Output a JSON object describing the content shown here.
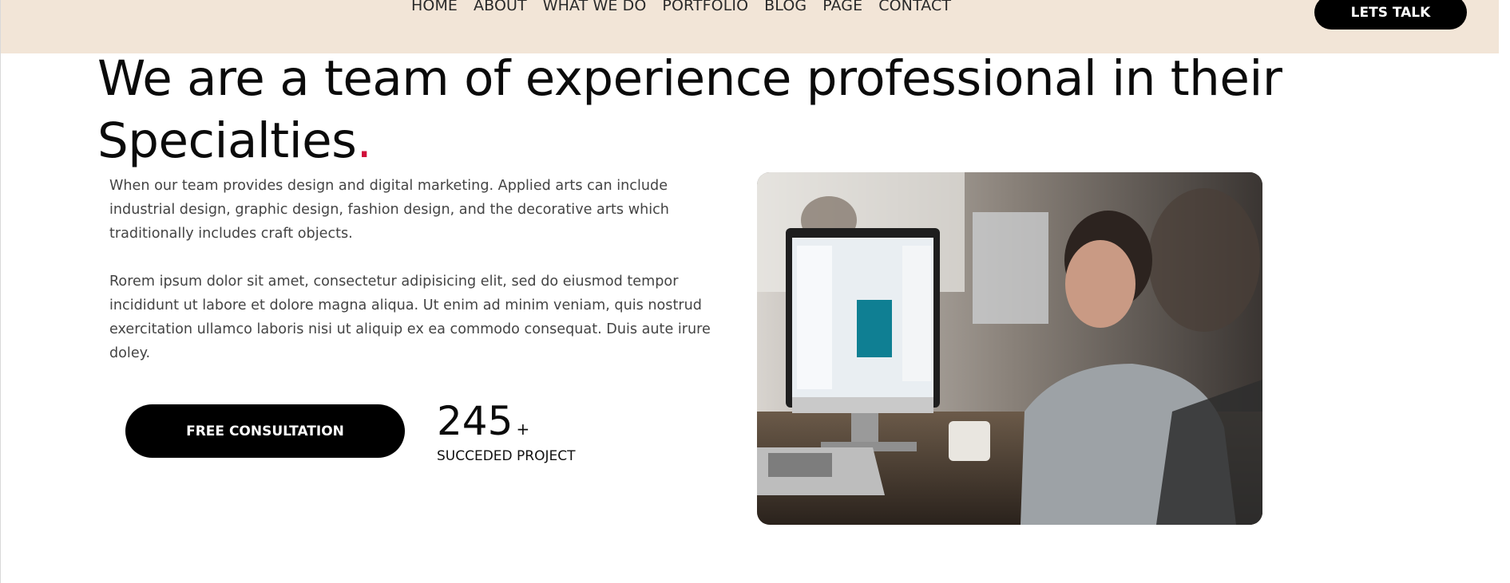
{
  "nav": {
    "links": [
      "HOME",
      "ABOUT",
      "WHAT WE DO",
      "PORTFOLIO",
      "BLOG",
      "PAGE",
      "CONTACT"
    ],
    "cta_label": "LETS TALK"
  },
  "hero": {
    "headline": "We are a team of experience professional in their Specialties",
    "headline_dot": ".",
    "paragraph_1": "When our team provides design and digital marketing. Applied arts can include industrial design, graphic design, fashion design, and the decorative arts which traditionally includes craft objects.",
    "paragraph_2": "Rorem ipsum dolor sit amet, consectetur adipisicing elit, sed do eiusmod tempor incididunt ut labore et dolore magna aliqua. Ut enim ad minim veniam, quis nostrud exercitation ullamco laboris nisi ut aliquip ex ea commodo consequat. Duis aute irure doley.",
    "cta_label": "FREE CONSULTATION",
    "stat_number": "245",
    "stat_suffix": "+",
    "stat_label": "SUCCEDED PROJECT"
  },
  "colors": {
    "navbar_bg": "#f2e5d7",
    "button_bg": "#000000",
    "accent_dot": "#d0103a"
  }
}
